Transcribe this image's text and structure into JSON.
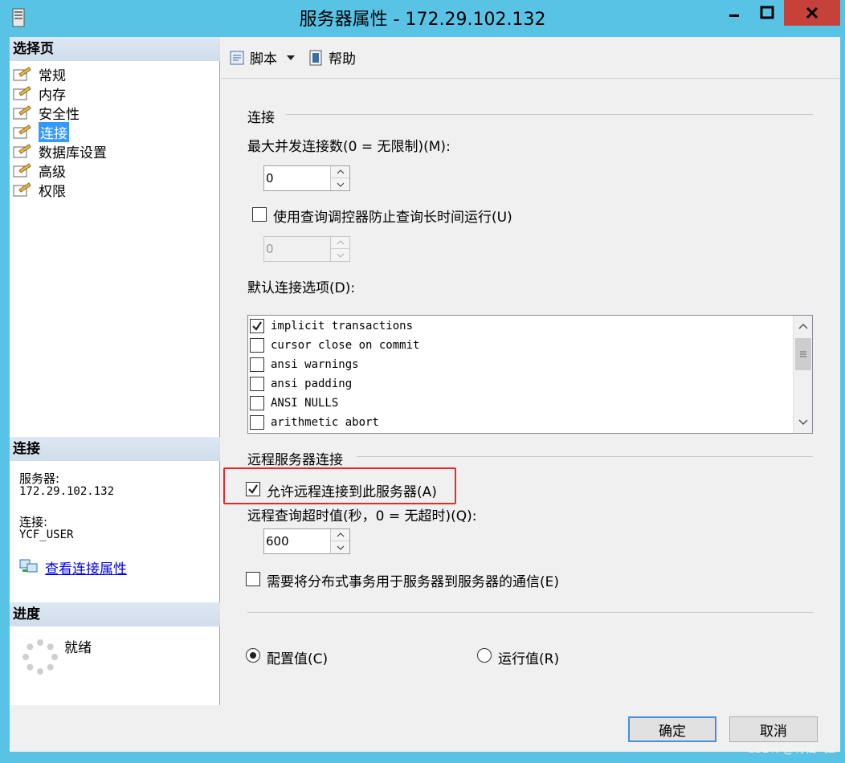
{
  "window": {
    "title": "服务器属性 - 172.29.102.132"
  },
  "left": {
    "select_page_header": "选择页",
    "pages": [
      {
        "label": "常规"
      },
      {
        "label": "内存"
      },
      {
        "label": "安全性"
      },
      {
        "label": "连接",
        "selected": true
      },
      {
        "label": "数据库设置"
      },
      {
        "label": "高级"
      },
      {
        "label": "权限"
      }
    ],
    "connection_header": "连接",
    "server_label": "服务器:",
    "server_value": "172.29.102.132",
    "connection_label": "连接:",
    "connection_value": "YCF_USER",
    "view_conn_link": "查看连接属性",
    "progress_header": "进度",
    "progress_status": "就绪"
  },
  "toolbar": {
    "script_label": "脚本",
    "help_label": "帮助"
  },
  "connection_group": {
    "title": "连接",
    "max_conn_label": "最大并发连接数(0 = 无限制)(M):",
    "max_conn_value": "0",
    "use_governor_label": "使用查询调控器防止查询长时间运行(U)",
    "use_governor_checked": false,
    "governor_value": "0",
    "default_options_label": "默认连接选项(D):",
    "options": [
      {
        "label": "implicit transactions",
        "checked": true
      },
      {
        "label": "cursor close on commit",
        "checked": false
      },
      {
        "label": "ansi warnings",
        "checked": false
      },
      {
        "label": "ansi padding",
        "checked": false
      },
      {
        "label": "ANSI NULLS",
        "checked": false
      },
      {
        "label": "arithmetic abort",
        "checked": false
      }
    ]
  },
  "remote_group": {
    "title": "远程服务器连接",
    "allow_remote_label": "允许远程连接到此服务器(A)",
    "allow_remote_checked": true,
    "timeout_label": "远程查询超时值(秒，0 = 无超时)(Q):",
    "timeout_value": "600",
    "distributed_label": "需要将分布式事务用于服务器到服务器的通信(E)",
    "distributed_checked": false
  },
  "mode": {
    "configured_label": "配置值(C)",
    "running_label": "运行值(R)",
    "selected": "configured"
  },
  "buttons": {
    "ok": "确定",
    "cancel": "取消"
  },
  "watermark": "CSDN @有仙气Z",
  "colors": {
    "titlebar": "#59c3e6",
    "close_button": "#c6413a",
    "selection": "#3399ff",
    "highlight_box": "#e32b2b"
  }
}
